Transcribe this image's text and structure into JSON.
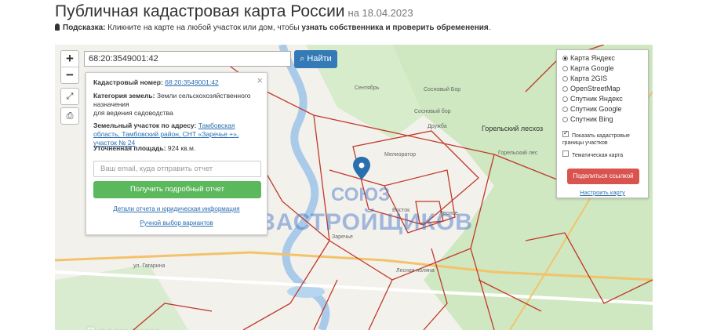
{
  "header": {
    "title": "Публичная кадастровая карта России",
    "date": "на 18.04.2023"
  },
  "hint": {
    "label": "Подсказка:",
    "text": "Кликните на карте на любой участок или дом, чтобы",
    "bold": "узнать собственника и проверить обременения",
    "end": "."
  },
  "search": {
    "value": "68:20:3549001:42",
    "button": "Найти"
  },
  "zoom": {
    "plus": "+",
    "minus": "−"
  },
  "panel": {
    "close": "×",
    "cad_label": "Кадастровый номер:",
    "cad_value": "68:20:3549001:42",
    "cat_label": "Категория земель:",
    "cat_value": "Земли сельскохозяйственного назначения",
    "cat_value2": "для ведения садоводства",
    "addr_label": "Земельный участок по адресу:",
    "addr_value": "Тамбовская область, Тамбовский район, СНТ «Заречье +», участок № 24",
    "area_label": "Уточненная площадь:",
    "area_value": "924 кв.м.",
    "email_placeholder": "Ваш email, куда отправить отчет",
    "report_button": "Получить подробный отчет",
    "details_link": "Детали отчета и юридическая информация",
    "manual_link": "Ручной выбор вариантов"
  },
  "layers": {
    "options": [
      {
        "label": "Карта Яндекс",
        "selected": true
      },
      {
        "label": "Карта Google",
        "selected": false
      },
      {
        "label": "Карта 2GIS",
        "selected": false
      },
      {
        "label": "OpenStreetMap",
        "selected": false
      },
      {
        "label": "Спутник Яндекс",
        "selected": false
      },
      {
        "label": "Спутник Google",
        "selected": false
      },
      {
        "label": "Спутник Bing",
        "selected": false
      }
    ],
    "show_borders": "Показать кадастровые границы участков",
    "thematic": "Тематическая карта",
    "share_button": "Поделиться ссылкой",
    "setup_link": "Настроить карту"
  },
  "map_labels": {
    "gorelsky": "Горельский лесхоз",
    "gagarina": "ул. Гагарина",
    "zarechye": "Заречье",
    "sentyabr": "Сентябрь",
    "sosnovy": "Сосновый Бор",
    "sosnovy2": "Сосновый бор",
    "druzhba": "Дружба",
    "melioratory": "Мелиоратор",
    "lesnaya": "Лесная поляна",
    "lesnoe": "Лесное",
    "vostok": "Восток",
    "gorelsky_les": "Горельский лес"
  },
  "watermarks": {
    "union": "СОЮЗ",
    "builders": "ЗАСТРОЙЩИКОВ",
    "domclick": "Домклик"
  },
  "colors": {
    "boundary": "#c0392b",
    "forest": "#cfe8c1",
    "water": "#b6d6f0",
    "accent": "#337ab7"
  }
}
